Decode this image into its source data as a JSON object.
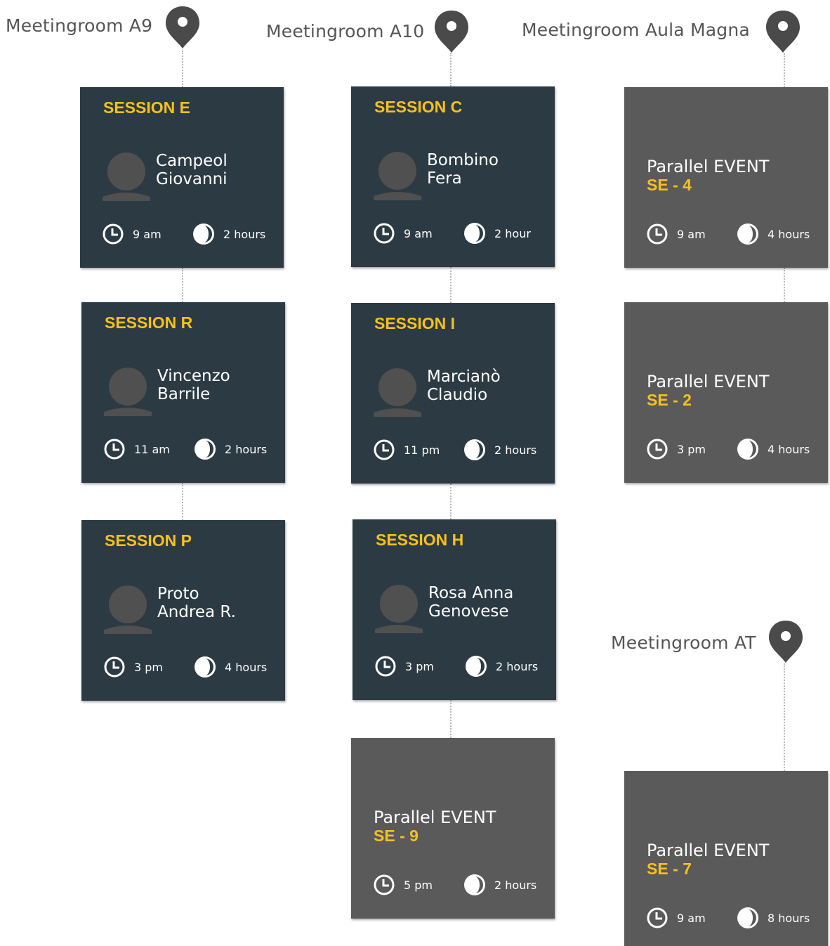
{
  "rooms": {
    "a9": {
      "label": "Meetingroom A9"
    },
    "a10": {
      "label": "Meetingroom A10"
    },
    "aula": {
      "label": "Meetingroom Aula Magna"
    },
    "at": {
      "label": "Meetingroom AT"
    }
  },
  "sessions": {
    "e": {
      "title": "SESSION E",
      "name1": "Campeol",
      "name2": "Giovanni",
      "time": "9 am",
      "duration": "2 hours"
    },
    "r": {
      "title": "SESSION R",
      "name1": "Vincenzo",
      "name2": "Barrile",
      "time": "11 am",
      "duration": "2 hours"
    },
    "p": {
      "title": "SESSION P",
      "name1": "Proto",
      "name2": "Andrea R.",
      "time": "3 pm",
      "duration": "4 hours"
    },
    "c": {
      "title": "SESSION C",
      "name1": "Bombino",
      "name2": "Fera",
      "time": "9 am",
      "duration": "2 hour"
    },
    "i": {
      "title": "SESSION I",
      "name1": "Marcianò",
      "name2": "Claudio",
      "time": "11 pm",
      "duration": "2 hours"
    },
    "h": {
      "title": "SESSION H",
      "name1": "Rosa Anna",
      "name2": "Genovese",
      "time": "3 pm",
      "duration": "2 hours"
    }
  },
  "events": {
    "se9": {
      "title": "Parallel EVENT",
      "code": "SE - 9",
      "time": "5 pm",
      "duration": "2 hours"
    },
    "se4": {
      "title": "Parallel EVENT",
      "code": "SE - 4",
      "time": "9 am",
      "duration": "4 hours"
    },
    "se2": {
      "title": "Parallel EVENT",
      "code": "SE - 2",
      "time": "3 pm",
      "duration": "4 hours"
    },
    "se7": {
      "title": "Parallel EVENT",
      "code": "SE - 7",
      "time": "9 am",
      "duration": "8 hours"
    }
  },
  "colors": {
    "session_bg": "#2c3a43",
    "event_bg": "#5a5a5b",
    "accent": "#f7c01d",
    "pin": "#4a4a4a"
  },
  "icons": {
    "pin": "map-pin-icon",
    "clock": "clock-icon",
    "duration": "duration-icon",
    "avatar": "avatar-icon"
  }
}
